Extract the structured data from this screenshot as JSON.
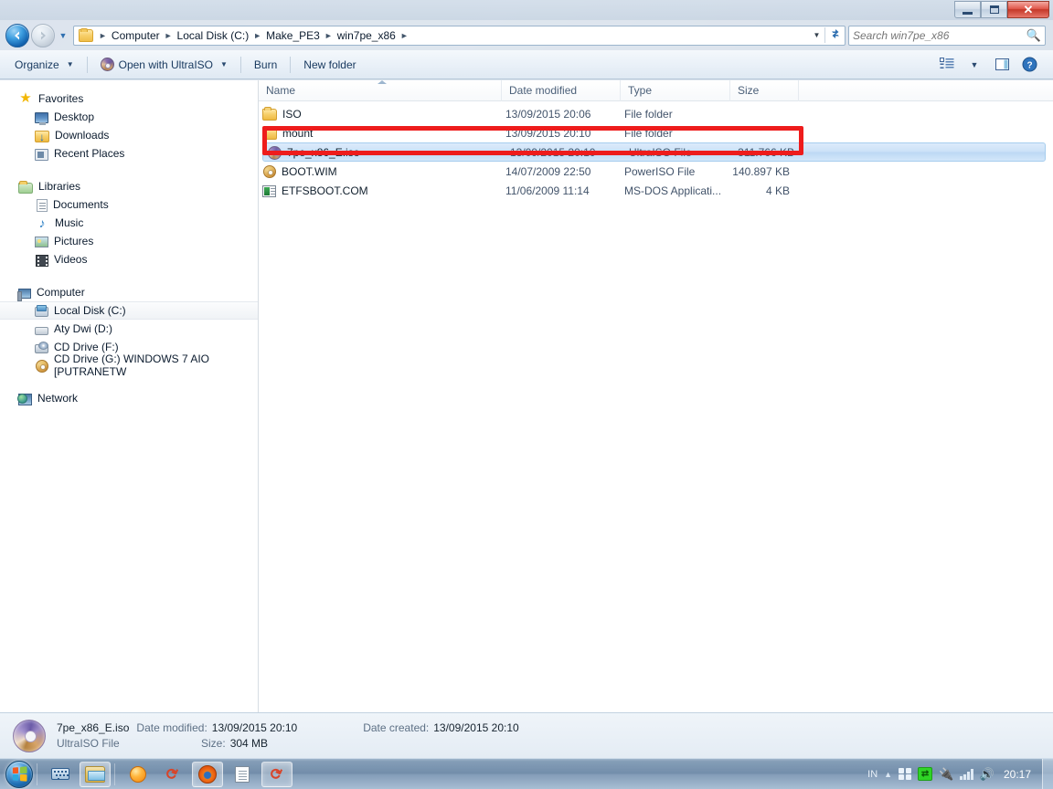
{
  "window": {
    "title": "win7pe_x86",
    "controls": {
      "minimize": "Minimize",
      "maximize": "Maximize",
      "close": "Close"
    }
  },
  "navigation": {
    "back_label": "Back",
    "forward_label": "Forward",
    "recent_pages_label": "Recent Pages",
    "breadcrumbs": [
      "Computer",
      "Local Disk (C:)",
      "Make_PE3",
      "win7pe_x86"
    ],
    "refresh_label": "Refresh"
  },
  "search": {
    "placeholder": "Search win7pe_x86",
    "value": ""
  },
  "toolbar": {
    "organize": "Organize",
    "open_with": "Open with UltraISO",
    "burn": "Burn",
    "new_folder": "New folder",
    "change_view_label": "Change your view",
    "preview_pane_label": "Show the preview pane",
    "help_label": "Get help"
  },
  "sidebar": {
    "groups": [
      {
        "name": "Favorites",
        "icon": "star-icon",
        "items": [
          {
            "label": "Desktop",
            "icon": "desktop-icon"
          },
          {
            "label": "Downloads",
            "icon": "downloads-icon"
          },
          {
            "label": "Recent Places",
            "icon": "recent-places-icon"
          }
        ]
      },
      {
        "name": "Libraries",
        "icon": "libraries-icon",
        "items": [
          {
            "label": "Documents",
            "icon": "document-icon"
          },
          {
            "label": "Music",
            "icon": "music-icon"
          },
          {
            "label": "Pictures",
            "icon": "pictures-icon"
          },
          {
            "label": "Videos",
            "icon": "videos-icon"
          }
        ]
      },
      {
        "name": "Computer",
        "icon": "computer-icon",
        "items": [
          {
            "label": "Local Disk (C:)",
            "icon": "harddisk-icon",
            "selected": true
          },
          {
            "label": "Aty Dwi (D:)",
            "icon": "drive-icon"
          },
          {
            "label": "CD Drive (F:)",
            "icon": "cd-drive-icon"
          },
          {
            "label": "CD Drive (G:) WINDOWS 7 AIO [PUTRANETW",
            "icon": "cd-disc-icon"
          }
        ]
      },
      {
        "name": "Network",
        "icon": "network-icon",
        "items": []
      }
    ]
  },
  "filelist": {
    "columns": [
      {
        "key": "name",
        "label": "Name",
        "sorted": "ascending"
      },
      {
        "key": "date",
        "label": "Date modified"
      },
      {
        "key": "type",
        "label": "Type"
      },
      {
        "key": "size",
        "label": "Size"
      }
    ],
    "rows": [
      {
        "name": "ISO",
        "date": "13/09/2015 20:06",
        "type": "File folder",
        "size": "",
        "icon": "folder-icon",
        "selected": false
      },
      {
        "name": "mount",
        "date": "13/09/2015 20:10",
        "type": "File folder",
        "size": "",
        "icon": "folder-icon",
        "selected": false
      },
      {
        "name": "7pe_x86_E.iso",
        "date": "13/09/2015 20:10",
        "type": "UltraISO File",
        "size": "311.766 KB",
        "icon": "iso-file-icon",
        "selected": true
      },
      {
        "name": "BOOT.WIM",
        "date": "14/07/2009 22:50",
        "type": "PowerISO File",
        "size": "140.897 KB",
        "icon": "wim-file-icon",
        "selected": false
      },
      {
        "name": "ETFSBOOT.COM",
        "date": "11/06/2009 11:14",
        "type": "MS-DOS Applicati...",
        "size": "4 KB",
        "icon": "dos-app-icon",
        "selected": false
      }
    ],
    "annotation": {
      "type": "highlight-rectangle",
      "color": "#ee1c1c",
      "target": "7pe_x86_E.iso"
    }
  },
  "details_pane": {
    "file_name": "7pe_x86_E.iso",
    "file_type": "UltraISO File",
    "date_modified_label": "Date modified:",
    "date_modified_value": "13/09/2015 20:10",
    "date_created_label": "Date created:",
    "date_created_value": "13/09/2015 20:10",
    "size_label": "Size:",
    "size_value": "304 MB"
  },
  "taskbar": {
    "start_label": "Start",
    "apps": [
      {
        "name": "on-screen-keyboard",
        "active": false
      },
      {
        "name": "windows-explorer",
        "active": true
      },
      {
        "name": "orange-app",
        "active": false
      },
      {
        "name": "poweriso-app",
        "active": false
      },
      {
        "name": "firefox",
        "active": true
      },
      {
        "name": "notepad",
        "active": false
      },
      {
        "name": "ultraiso-app",
        "active": true
      }
    ],
    "tray": {
      "language": "IN",
      "show_hidden_label": "Show hidden icons",
      "action_center": "action-center-icon",
      "network_transfer": "network-transfer-icon",
      "safely_remove": "safely-remove-icon",
      "network_signal": "network-signal-icon",
      "volume": "volume-icon",
      "clock": "20:17"
    }
  },
  "colors": {
    "annotation_red": "#ee1c1c",
    "selection_blue": "#bdd8f4",
    "taskbar_blue": "#6e8aa8"
  }
}
